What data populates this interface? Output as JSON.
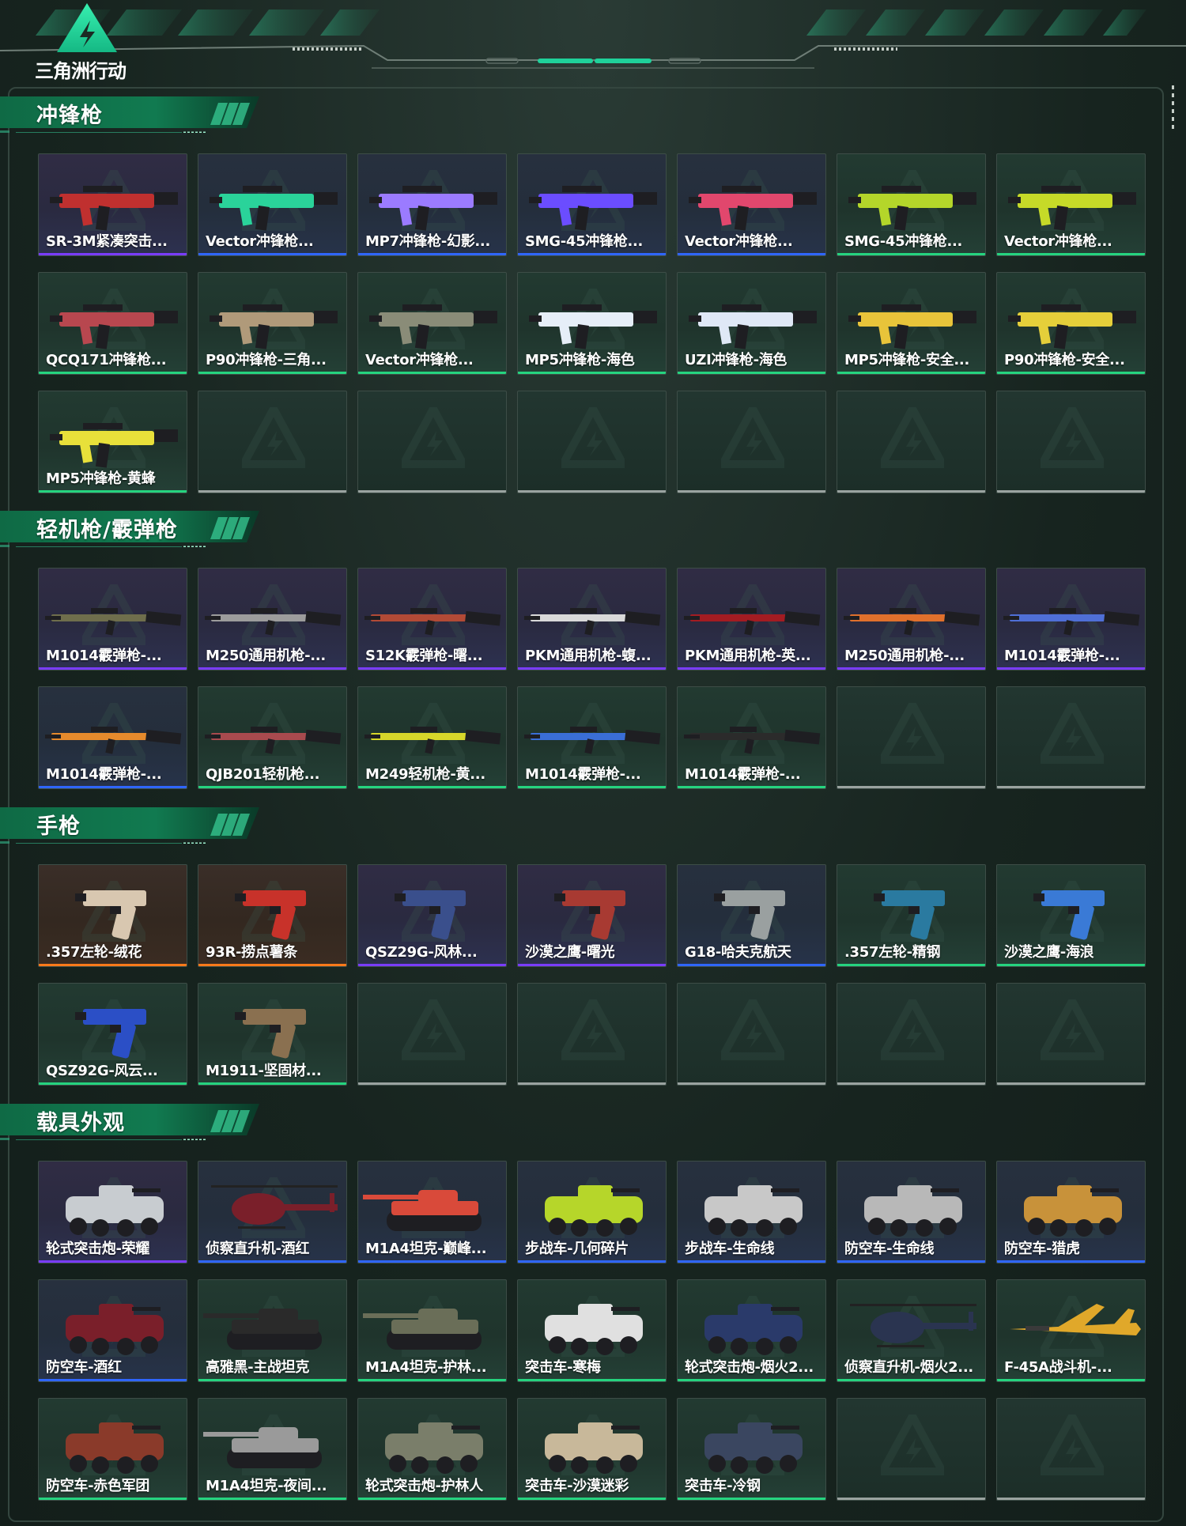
{
  "header": {
    "logo_text": "三角洲行动"
  },
  "colors": {
    "accent": "#1fd19a",
    "purple": "#7a3cff",
    "blue": "#2f66ff",
    "green": "#25d47f",
    "orange": "#ff7a1a",
    "empty": "#9aa3a0"
  },
  "sections": [
    {
      "title": "冲锋枪",
      "items": [
        {
          "label": "SR-3M紧凑突击...",
          "quality": "purple",
          "icon": "smg-icon",
          "color": "#c0302f"
        },
        {
          "label": "Vector冲锋枪...",
          "quality": "blue",
          "icon": "smg-icon",
          "color": "#2ad39a"
        },
        {
          "label": "MP7冲锋枪-幻影...",
          "quality": "blue",
          "icon": "smg-icon",
          "color": "#9b7bff"
        },
        {
          "label": "SMG-45冲锋枪...",
          "quality": "blue",
          "icon": "smg-icon",
          "color": "#6b4dff"
        },
        {
          "label": "Vector冲锋枪...",
          "quality": "blue",
          "icon": "smg-icon",
          "color": "#e1476d"
        },
        {
          "label": "SMG-45冲锋枪...",
          "quality": "green",
          "icon": "smg-icon",
          "color": "#b4d62a"
        },
        {
          "label": "Vector冲锋枪...",
          "quality": "green",
          "icon": "smg-icon",
          "color": "#c6da28"
        },
        {
          "label": "QCQ171冲锋枪...",
          "quality": "green",
          "icon": "smg-icon",
          "color": "#b8474f"
        },
        {
          "label": "P90冲锋枪-三角...",
          "quality": "green",
          "icon": "smg-icon",
          "color": "#b09a7a"
        },
        {
          "label": "Vector冲锋枪...",
          "quality": "green",
          "icon": "smg-icon",
          "color": "#8a8c78"
        },
        {
          "label": "MP5冲锋枪-海色",
          "quality": "green",
          "icon": "smg-icon",
          "color": "#e6eef8"
        },
        {
          "label": "UZI冲锋枪-海色",
          "quality": "green",
          "icon": "smg-icon",
          "color": "#dfe8f6"
        },
        {
          "label": "MP5冲锋枪-安全...",
          "quality": "green",
          "icon": "smg-icon",
          "color": "#e8c43a"
        },
        {
          "label": "P90冲锋枪-安全...",
          "quality": "green",
          "icon": "smg-icon",
          "color": "#e5cf3a"
        },
        {
          "label": "MP5冲锋枪-黄蜂",
          "quality": "green",
          "icon": "smg-icon",
          "color": "#e8e03a"
        }
      ],
      "slots": 21
    },
    {
      "title": "轻机枪/霰弹枪",
      "items": [
        {
          "label": "M1014霰弹枪-...",
          "quality": "purple",
          "icon": "rifle-icon",
          "color": "#6f6e4c"
        },
        {
          "label": "M250通用机枪-...",
          "quality": "purple",
          "icon": "rifle-icon",
          "color": "#9c9c9c"
        },
        {
          "label": "S12K霰弹枪-曙...",
          "quality": "purple",
          "icon": "rifle-icon",
          "color": "#b24a36"
        },
        {
          "label": "PKM通用机枪-蝮...",
          "quality": "purple",
          "icon": "rifle-icon",
          "color": "#d9d9d9"
        },
        {
          "label": "PKM通用机枪-英...",
          "quality": "purple",
          "icon": "rifle-icon",
          "color": "#a31c22"
        },
        {
          "label": "M250通用机枪-...",
          "quality": "purple",
          "icon": "rifle-icon",
          "color": "#e0702c"
        },
        {
          "label": "M1014霰弹枪-...",
          "quality": "purple",
          "icon": "rifle-icon",
          "color": "#4f6fd6"
        },
        {
          "label": "M1014霰弹枪-...",
          "quality": "blue",
          "icon": "rifle-icon",
          "color": "#e58a2c"
        },
        {
          "label": "QJB201轻机枪...",
          "quality": "green",
          "icon": "rifle-icon",
          "color": "#a84a4e"
        },
        {
          "label": "M249轻机枪-黄...",
          "quality": "green",
          "icon": "rifle-icon",
          "color": "#d7d62a"
        },
        {
          "label": "M1014霰弹枪-...",
          "quality": "green",
          "icon": "rifle-icon",
          "color": "#3a6ed6"
        },
        {
          "label": "M1014霰弹枪-...",
          "quality": "green",
          "icon": "rifle-icon",
          "color": "#2b2b2b"
        }
      ],
      "slots": 14
    },
    {
      "title": "手枪",
      "items": [
        {
          "label": ".357左轮-绒花",
          "quality": "orange",
          "icon": "pistol-icon",
          "color": "#d8c7b0"
        },
        {
          "label": "93R-捞点薯条",
          "quality": "orange",
          "icon": "pistol-icon",
          "color": "#c8322a"
        },
        {
          "label": "QSZ29G-风林...",
          "quality": "purple",
          "icon": "pistol-icon",
          "color": "#3a4f8c"
        },
        {
          "label": "沙漠之鹰-曙光",
          "quality": "purple",
          "icon": "pistol-icon",
          "color": "#a83a32"
        },
        {
          "label": "G18-哈夫克航天",
          "quality": "blue",
          "icon": "pistol-icon",
          "color": "#9aa0a0"
        },
        {
          "label": ".357左轮-精钢",
          "quality": "green",
          "icon": "pistol-icon",
          "color": "#2a7aa0"
        },
        {
          "label": "沙漠之鹰-海浪",
          "quality": "green",
          "icon": "pistol-icon",
          "color": "#3a7ad6"
        },
        {
          "label": "QSZ92G-风云...",
          "quality": "green",
          "icon": "pistol-icon",
          "color": "#2b4fc6"
        },
        {
          "label": "M1911-坚固材...",
          "quality": "green",
          "icon": "pistol-icon",
          "color": "#8a7050"
        }
      ],
      "slots": 14
    },
    {
      "title": "载具外观",
      "items": [
        {
          "label": "轮式突击炮-荣耀",
          "quality": "purple",
          "icon": "vehicle-icon",
          "color": "#c8ccd0"
        },
        {
          "label": "侦察直升机-酒红",
          "quality": "blue",
          "icon": "helicopter-icon",
          "color": "#7a1f2a"
        },
        {
          "label": "M1A4坦克-巅峰...",
          "quality": "blue",
          "icon": "tank-icon",
          "color": "#d94a3a"
        },
        {
          "label": "步战车-几何碎片",
          "quality": "blue",
          "icon": "vehicle-icon",
          "color": "#b6d62a"
        },
        {
          "label": "步战车-生命线",
          "quality": "blue",
          "icon": "vehicle-icon",
          "color": "#c8c8c8"
        },
        {
          "label": "防空车-生命线",
          "quality": "blue",
          "icon": "vehicle-icon",
          "color": "#b8b8b8"
        },
        {
          "label": "防空车-猎虎",
          "quality": "blue",
          "icon": "vehicle-icon",
          "color": "#c8923a"
        },
        {
          "label": "防空车-酒红",
          "quality": "blue",
          "icon": "vehicle-icon",
          "color": "#7a1f2a"
        },
        {
          "label": "高雅黑-主战坦克",
          "quality": "green",
          "icon": "tank-icon",
          "color": "#2a2a2a"
        },
        {
          "label": "M1A4坦克-护林...",
          "quality": "green",
          "icon": "tank-icon",
          "color": "#6a6e58"
        },
        {
          "label": "突击车-寒梅",
          "quality": "green",
          "icon": "vehicle-icon",
          "color": "#e0e0e0"
        },
        {
          "label": "轮式突击炮-烟火2...",
          "quality": "green",
          "icon": "vehicle-icon",
          "color": "#2a3a6a"
        },
        {
          "label": "侦察直升机-烟火2...",
          "quality": "green",
          "icon": "helicopter-icon",
          "color": "#2a3450"
        },
        {
          "label": "F-45A战斗机-...",
          "quality": "green",
          "icon": "jet-icon",
          "color": "#e0a82a"
        },
        {
          "label": "防空车-赤色军团",
          "quality": "green",
          "icon": "vehicle-icon",
          "color": "#8a3a2a"
        },
        {
          "label": "M1A4坦克-夜间...",
          "quality": "green",
          "icon": "tank-icon",
          "color": "#9a9a9a"
        },
        {
          "label": "轮式突击炮-护林人",
          "quality": "green",
          "icon": "vehicle-icon",
          "color": "#7a7e6a"
        },
        {
          "label": "突击车-沙漠迷彩",
          "quality": "green",
          "icon": "vehicle-icon",
          "color": "#c8b89a"
        },
        {
          "label": "突击车-冷钢",
          "quality": "green",
          "icon": "vehicle-icon",
          "color": "#3a4660"
        }
      ],
      "slots": 21
    }
  ]
}
